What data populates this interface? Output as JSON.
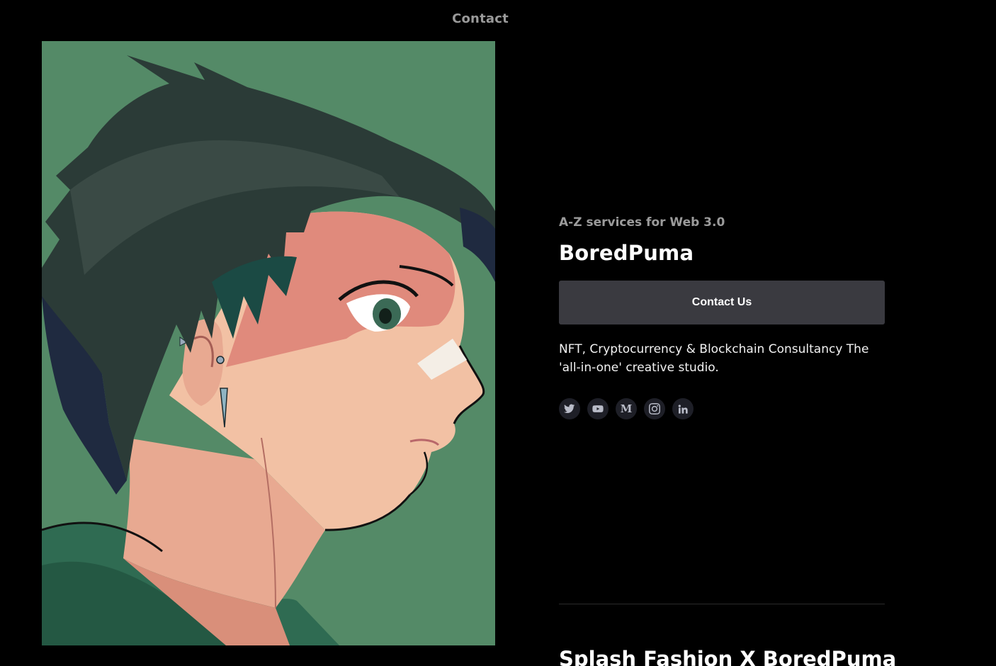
{
  "nav": {
    "contact_label": "Contact"
  },
  "hero": {
    "eyebrow": "A-Z services for Web 3.0",
    "title": "BoredPuma",
    "cta_label": "Contact Us",
    "description": "NFT, Cryptocurrency & Blockchain Consultancy The 'all-in-one' creative studio."
  },
  "socials": [
    {
      "icon": "twitter-icon"
    },
    {
      "icon": "youtube-icon"
    },
    {
      "icon": "medium-icon",
      "glyph": "M"
    },
    {
      "icon": "instagram-icon"
    },
    {
      "icon": "linkedin-icon"
    }
  ],
  "next_section": {
    "title": "Splash Fashion X BoredPuma"
  },
  "colors": {
    "background": "#000000",
    "art_background": "#548a67",
    "button_bg": "#3a3a40",
    "muted_text": "#9b9b9b",
    "social_bg": "#1e1f27"
  }
}
